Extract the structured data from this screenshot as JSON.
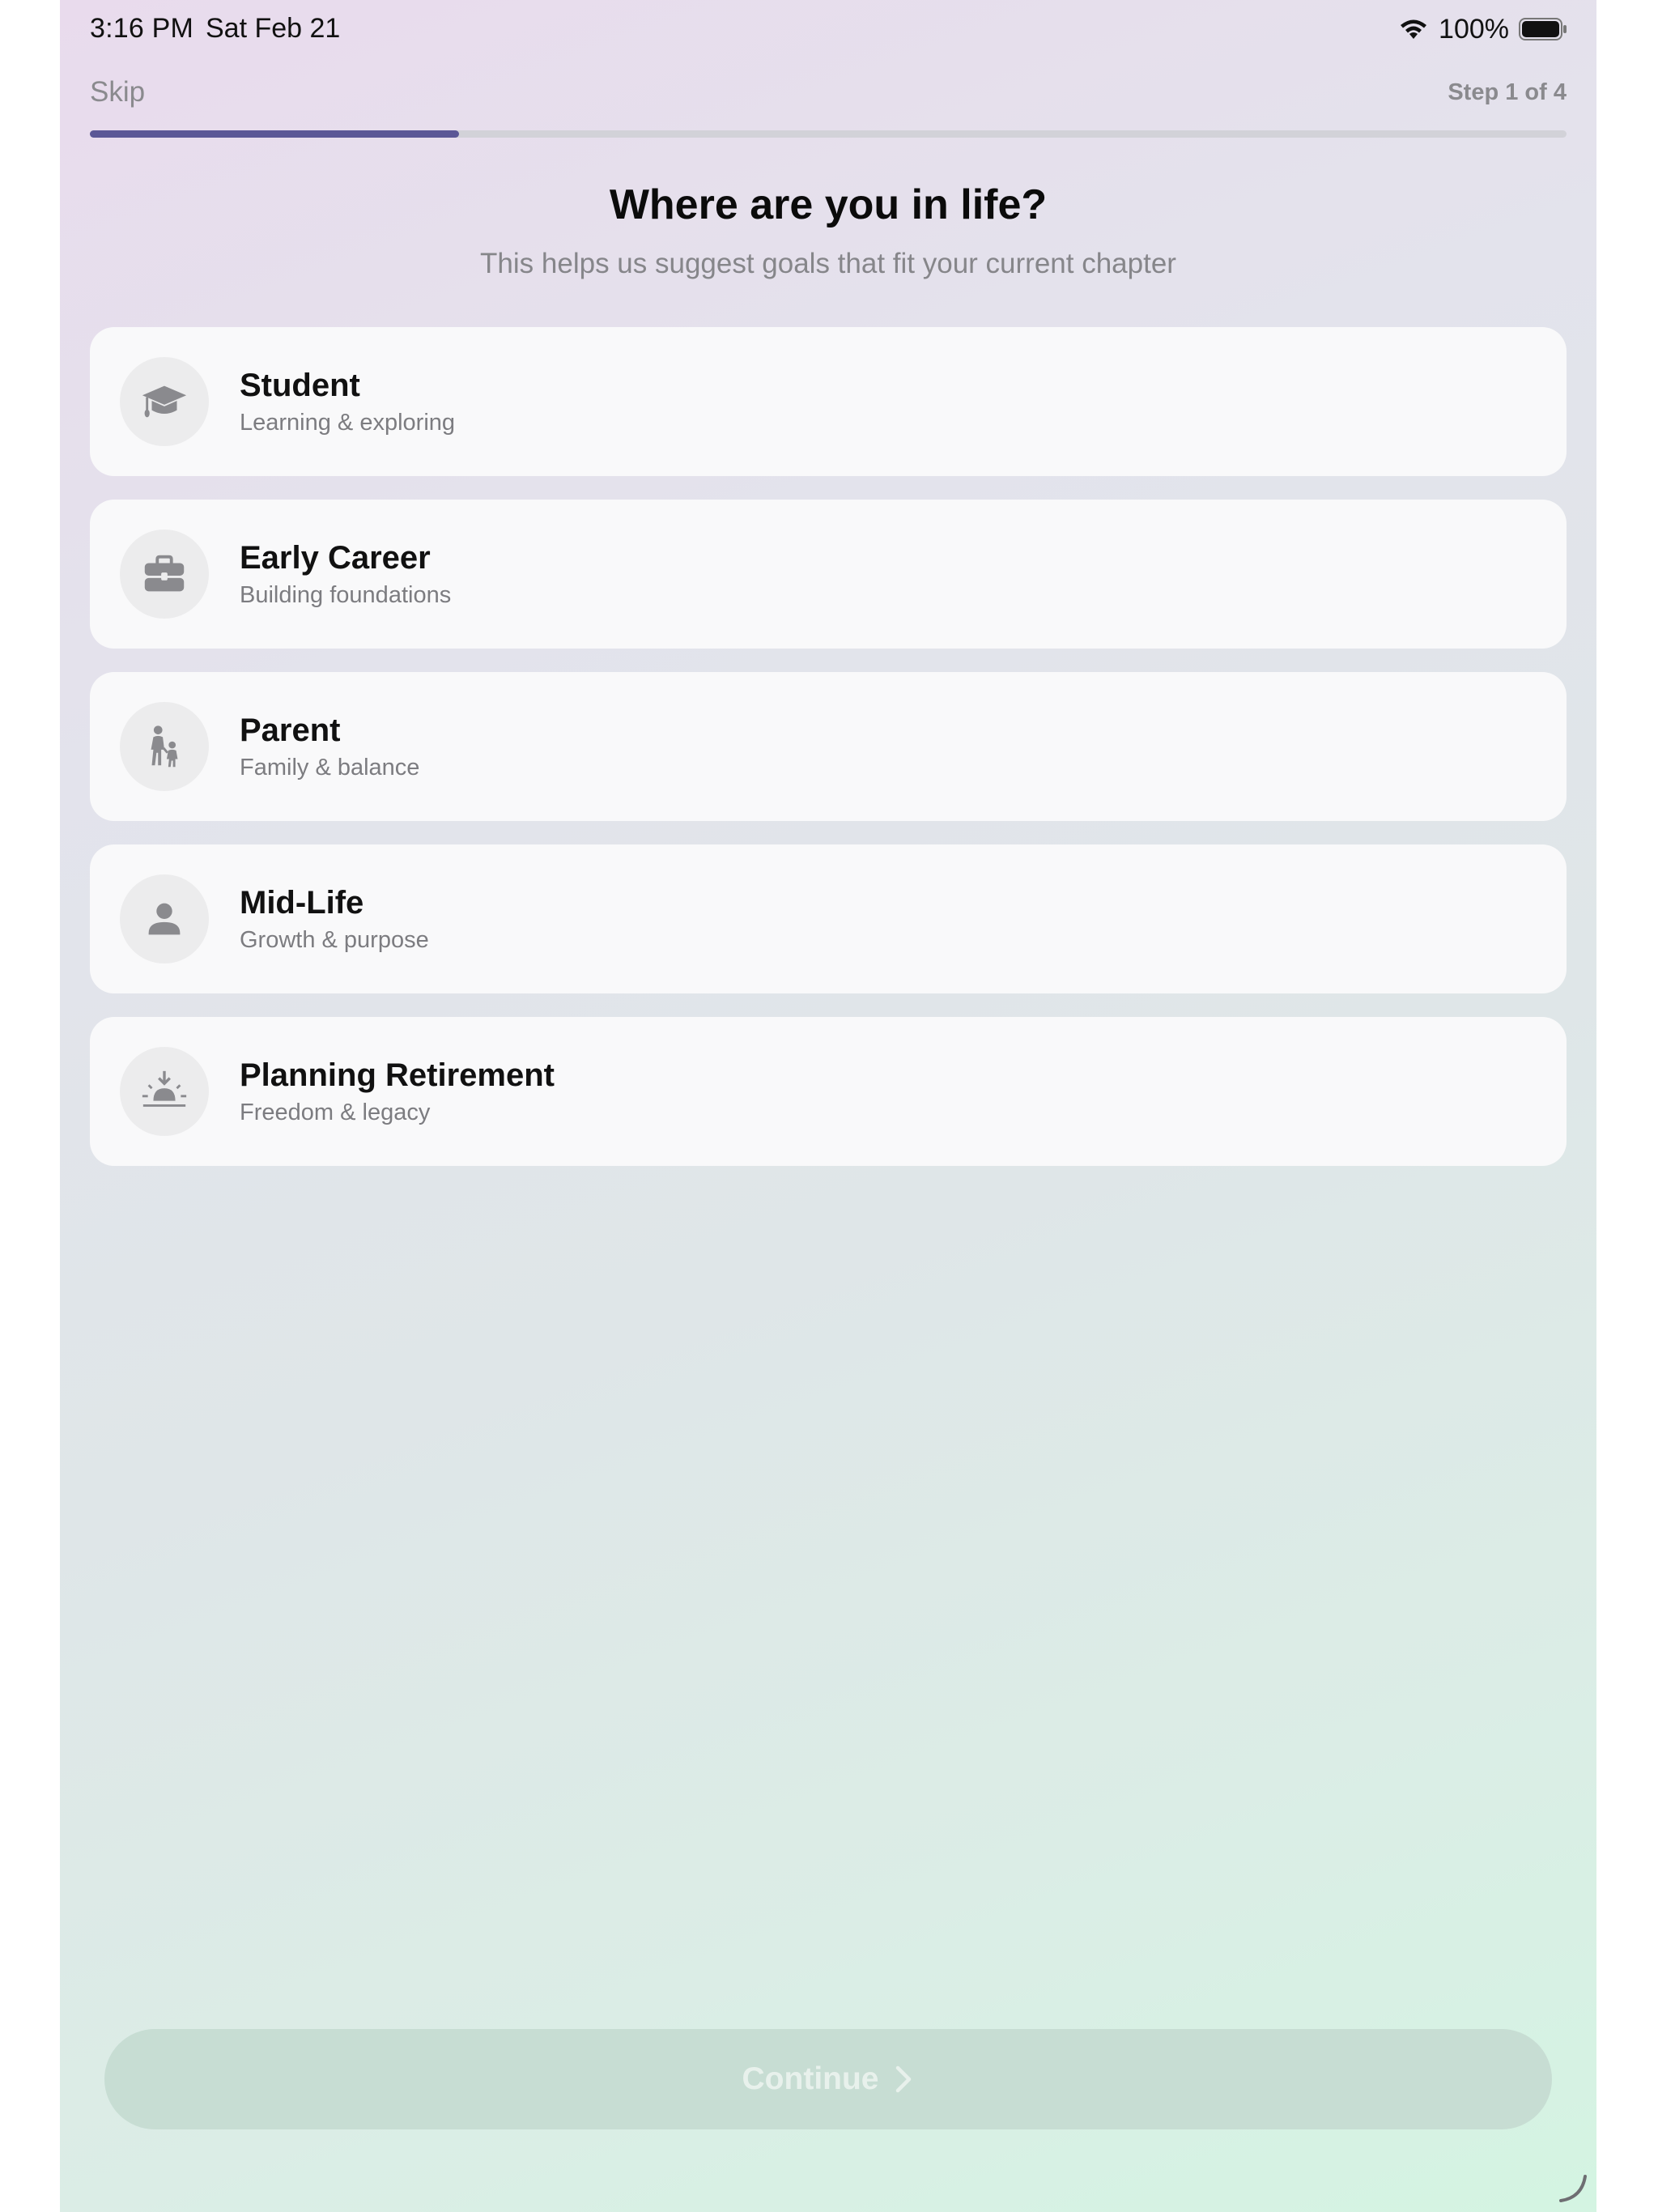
{
  "status_bar": {
    "time": "3:16 PM",
    "date": "Sat Feb 21",
    "battery": "100%",
    "icons": [
      "wifi-icon",
      "battery-icon"
    ]
  },
  "header": {
    "skip_label": "Skip",
    "step_label": "Step 1 of 4",
    "progress_fraction": 0.25
  },
  "title": "Where are you in life?",
  "subtitle": "This helps us suggest goals that fit your current chapter",
  "options": [
    {
      "title": "Student",
      "subtitle": "Learning & exploring",
      "icon": "graduation-cap-icon"
    },
    {
      "title": "Early Career",
      "subtitle": "Building foundations",
      "icon": "briefcase-icon"
    },
    {
      "title": "Parent",
      "subtitle": "Family & balance",
      "icon": "parent-child-icon"
    },
    {
      "title": "Mid-Life",
      "subtitle": "Growth & purpose",
      "icon": "person-icon"
    },
    {
      "title": "Planning Retirement",
      "subtitle": "Freedom & legacy",
      "icon": "sunset-icon"
    }
  ],
  "continue_label": "Continue",
  "colors": {
    "progress_fill": "#5b5796",
    "progress_track": "#d2d2d8",
    "continue_disabled": "#c7ddd3",
    "icon_gray": "#8a8a8e"
  }
}
